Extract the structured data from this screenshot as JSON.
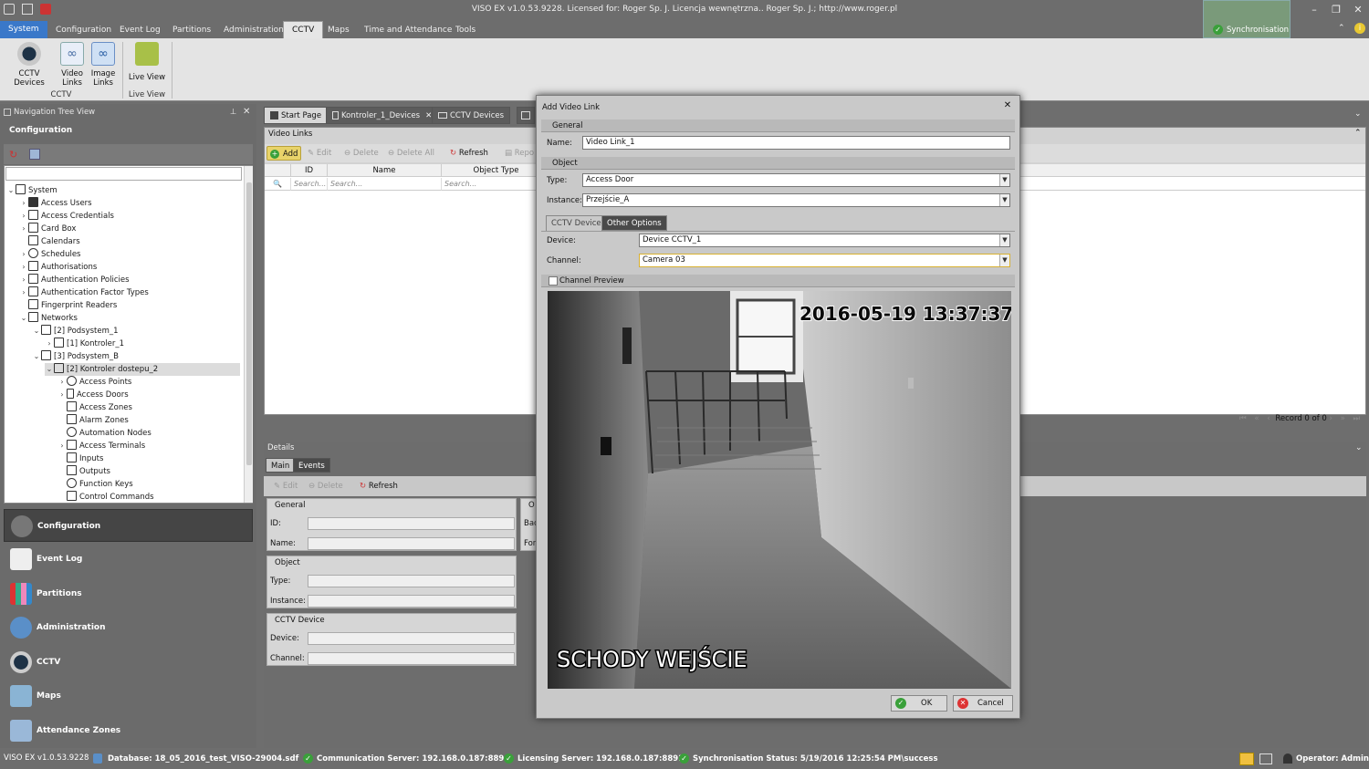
{
  "window": {
    "title": "VISO EX v1.0.53.9228. Licensed for: Roger Sp. J. Licencja wewnętrzna.. Roger Sp. J.; http://www.roger.pl",
    "sync_label": "Synchronisation"
  },
  "menu": [
    "System",
    "Configuration",
    "Event Log",
    "Partitions",
    "Administration",
    "CCTV",
    "Maps",
    "Time and Attendance",
    "Tools"
  ],
  "ribbon": {
    "buttons": [
      {
        "label": "CCTV Devices"
      },
      {
        "label": "Video Links"
      },
      {
        "label": "Image Links"
      },
      {
        "label": "Live View"
      }
    ],
    "groups": [
      "CCTV",
      "Live View"
    ]
  },
  "nav": {
    "panel_title": "Navigation Tree View",
    "config_label": "Configuration",
    "tree": [
      {
        "label": "System"
      },
      {
        "label": "Access Users"
      },
      {
        "label": "Access Credentials"
      },
      {
        "label": "Card Box"
      },
      {
        "label": "Calendars"
      },
      {
        "label": "Schedules"
      },
      {
        "label": "Authorisations"
      },
      {
        "label": "Authentication Policies"
      },
      {
        "label": "Authentication Factor Types"
      },
      {
        "label": "Fingerprint Readers"
      },
      {
        "label": "Networks"
      },
      {
        "label": "[2] Podsystem_1"
      },
      {
        "label": "[1] Kontroler_1"
      },
      {
        "label": "[3] Podsystem_B"
      },
      {
        "label": "[2] Kontroler dostepu_2"
      },
      {
        "label": "Access Points"
      },
      {
        "label": "Access Doors"
      },
      {
        "label": "Access Zones"
      },
      {
        "label": "Alarm Zones"
      },
      {
        "label": "Automation Nodes"
      },
      {
        "label": "Access Terminals"
      },
      {
        "label": "Inputs"
      },
      {
        "label": "Outputs"
      },
      {
        "label": "Function Keys"
      },
      {
        "label": "Control Commands"
      }
    ],
    "modules": [
      "Configuration",
      "Event Log",
      "Partitions",
      "Administration",
      "CCTV",
      "Maps",
      "Attendance Zones"
    ]
  },
  "doc_tabs": [
    "Start Page",
    "Kontroler_1_Devices",
    "CCTV Devices"
  ],
  "video_links": {
    "title": "Video Links",
    "toolbar": [
      "Add",
      "Edit",
      "Delete",
      "Delete All",
      "Refresh",
      "Repo"
    ],
    "columns": [
      "ID",
      "Name",
      "Object Type"
    ],
    "search_placeholder": "Search...",
    "pager": "Record 0 of 0"
  },
  "details": {
    "title": "Details",
    "tabs": [
      "Main",
      "Events"
    ],
    "toolbar": [
      "Edit",
      "Delete",
      "Refresh"
    ],
    "groups": {
      "general": "General",
      "object": "Object",
      "cctv": "CCTV Device",
      "other_header": "O"
    },
    "labels": {
      "id": "ID:",
      "name": "Name:",
      "type": "Type:",
      "instance": "Instance:",
      "device": "Device:",
      "channel": "Channel:",
      "bac": "Bac",
      "for": "For"
    }
  },
  "dialog": {
    "title": "Add Video Link",
    "general_section": "General",
    "name_label": "Name:",
    "name_value": "Video Link_1",
    "object_section": "Object",
    "type_label": "Type:",
    "type_value": "Access Door",
    "instance_label": "Instance:",
    "instance_value": "Przejście_A",
    "tabs": [
      "CCTV Device",
      "Other Options"
    ],
    "device_label": "Device:",
    "device_value": "Device CCTV_1",
    "channel_label": "Channel:",
    "channel_value": "Camera 03",
    "preview_label": "Channel Preview",
    "camera_timestamp": "2016-05-19 13:37:37",
    "camera_caption": "SCHODY WEJŚCIE",
    "ok_label": "OK",
    "cancel_label": "Cancel"
  },
  "status": {
    "version": "VISO EX v1.0.53.9228",
    "database": "Database: 18_05_2016_test_VISO-29004.sdf",
    "comm_server": "Communication Server: 192.168.0.187:8890",
    "licensing": "Licensing Server: 192.168.0.187:8891",
    "sync_status": "Synchronisation Status: 5/19/2016 12:25:54 PM\\success",
    "operator": "Operator: Admin"
  },
  "colors": {
    "chrome_gray": "#6d6d6d",
    "active_menu_blue": "#3a78c9",
    "ok_green": "#3aa03a",
    "cancel_red": "#d33"
  }
}
